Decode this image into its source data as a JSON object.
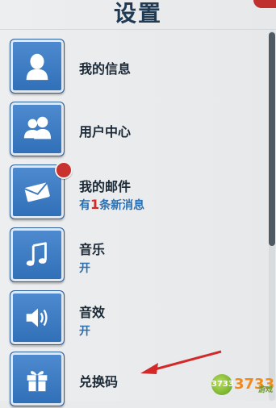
{
  "header": {
    "title": "设置"
  },
  "menu": [
    {
      "label": "我的信息",
      "icon": "user-silhouette-icon"
    },
    {
      "label": "用户中心",
      "icon": "users-group-icon"
    },
    {
      "label": "我的邮件",
      "icon": "mail-envelope-icon",
      "sub_prefix": "有",
      "sub_count": "1",
      "sub_suffix": "条新消息"
    },
    {
      "label": "音乐",
      "icon": "music-note-icon",
      "sub": "开"
    },
    {
      "label": "音效",
      "icon": "speaker-icon",
      "sub": "开"
    },
    {
      "label": "兑换码",
      "icon": "gift-box-icon"
    }
  ],
  "watermark": {
    "circle_text": "3733",
    "text": "3733",
    "small": "游戏"
  },
  "colors": {
    "title": "#1f3a52",
    "tile": "#3a78c0",
    "badge": "#c8322f",
    "status_on": "#2b6fb1",
    "arrow": "#d22a2a"
  }
}
